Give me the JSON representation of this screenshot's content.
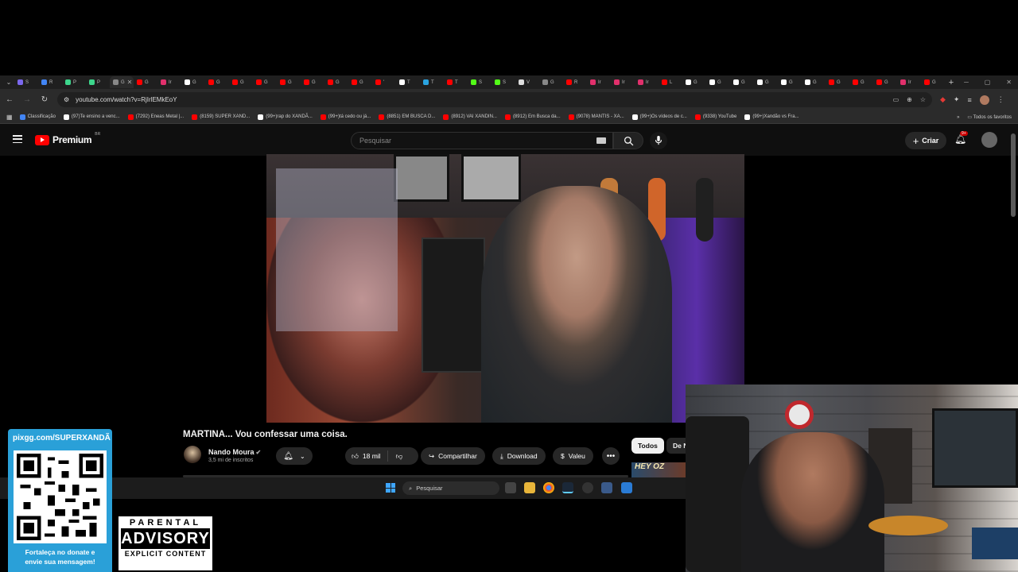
{
  "browser": {
    "tabs": [
      {
        "label": "S",
        "color": "#7b68ee"
      },
      {
        "label": "R",
        "color": "#4285f4"
      },
      {
        "label": "P",
        "color": "#3dd68c"
      },
      {
        "label": "P",
        "color": "#3dd68c"
      },
      {
        "label": "G",
        "color": "#888888",
        "active": true
      },
      {
        "label": "G",
        "color": "#ff0000"
      },
      {
        "label": "Ir",
        "color": "#e1306c"
      },
      {
        "label": "G",
        "color": "#ffffff"
      },
      {
        "label": "G",
        "color": "#ff0000"
      },
      {
        "label": "G",
        "color": "#ff0000"
      },
      {
        "label": "G",
        "color": "#ff0000"
      },
      {
        "label": "G",
        "color": "#ff0000"
      },
      {
        "label": "G",
        "color": "#ff0000"
      },
      {
        "label": "G",
        "color": "#ff0000"
      },
      {
        "label": "G",
        "color": "#ff0000"
      },
      {
        "label": "'",
        "color": "#ff0000"
      },
      {
        "label": "T",
        "color": "#ffffff"
      },
      {
        "label": "T",
        "color": "#2aa3e0"
      },
      {
        "label": "T",
        "color": "#ff0000"
      },
      {
        "label": "S",
        "color": "#53fc18"
      },
      {
        "label": "S",
        "color": "#53fc18"
      },
      {
        "label": "V",
        "color": "#dddddd"
      },
      {
        "label": "G",
        "color": "#888888"
      },
      {
        "label": "R",
        "color": "#ff0000"
      },
      {
        "label": "Ir",
        "color": "#e1306c"
      },
      {
        "label": "Ir",
        "color": "#e1306c"
      },
      {
        "label": "Ir",
        "color": "#e1306c"
      },
      {
        "label": "L",
        "color": "#ff0000"
      },
      {
        "label": "G",
        "color": "#ffffff"
      },
      {
        "label": "G",
        "color": "#ffffff"
      },
      {
        "label": "G",
        "color": "#ffffff"
      },
      {
        "label": "G",
        "color": "#ffffff"
      },
      {
        "label": "G",
        "color": "#ffffff"
      },
      {
        "label": "G",
        "color": "#ffffff"
      },
      {
        "label": "G",
        "color": "#ff0000"
      },
      {
        "label": "G",
        "color": "#ff0000"
      },
      {
        "label": "G",
        "color": "#ff0000"
      },
      {
        "label": "Ir",
        "color": "#e1306c"
      },
      {
        "label": "G",
        "color": "#ff0000"
      }
    ],
    "new_tab": "+",
    "url": "youtube.com/watch?v=RjIrlEMkEoY",
    "bookmarks": [
      {
        "label": "Classificação",
        "color": "#4285f4"
      },
      {
        "label": "(97)Te ensino a venc...",
        "color": "#ffffff"
      },
      {
        "label": "(7292) Eneas Metal |...",
        "color": "#ff0000"
      },
      {
        "label": "(8159) SUPER XAND...",
        "color": "#ff0000"
      },
      {
        "label": "(99+)rap do XANDÃ...",
        "color": "#ffffff"
      },
      {
        "label": "(99+)tá cedo ou já...",
        "color": "#ff0000"
      },
      {
        "label": "(8851) EM BUSCA D...",
        "color": "#ff0000"
      },
      {
        "label": "(8912) VAI XANDIN...",
        "color": "#ff0000"
      },
      {
        "label": "(8912) Em Busca da...",
        "color": "#ff0000"
      },
      {
        "label": "(9078) MANTIS - XA...",
        "color": "#ff0000"
      },
      {
        "label": "(99+)Os vídeos de c...",
        "color": "#ffffff"
      },
      {
        "label": "(9338) YouTube",
        "color": "#ff0000"
      },
      {
        "label": "(99+)Xandão vs Fra...",
        "color": "#ffffff"
      }
    ],
    "bookmarks_more": "»",
    "all_bookmarks": "Todos os favoritos"
  },
  "youtube": {
    "logo_text": "Premium",
    "logo_region": "BR",
    "search_placeholder": "Pesquisar",
    "create_label": "Criar",
    "notif_badge": "9+",
    "video": {
      "title": "MARTINA... Vou confessar uma coisa.",
      "channel": "Nando Moura",
      "subscribers": "3,5 mi de inscritos",
      "likes": "18 mil",
      "share": "Compartilhar",
      "download": "Download",
      "thanks": "Valeu"
    },
    "chips": [
      "Todos",
      "De N"
    ],
    "thumb_text": "HEY OZ"
  },
  "taskbar": {
    "search_placeholder": "Pesquisar"
  },
  "overlay": {
    "qr_url": "pixgg.com/SUPERXANDÃ",
    "qr_caption_line1": "Fortaleça no donate e",
    "qr_caption_line2": "envie sua mensagem!",
    "advisory_top": "PARENTAL",
    "advisory_mid": "ADVISORY",
    "advisory_bot": "EXPLICIT CONTENT"
  }
}
